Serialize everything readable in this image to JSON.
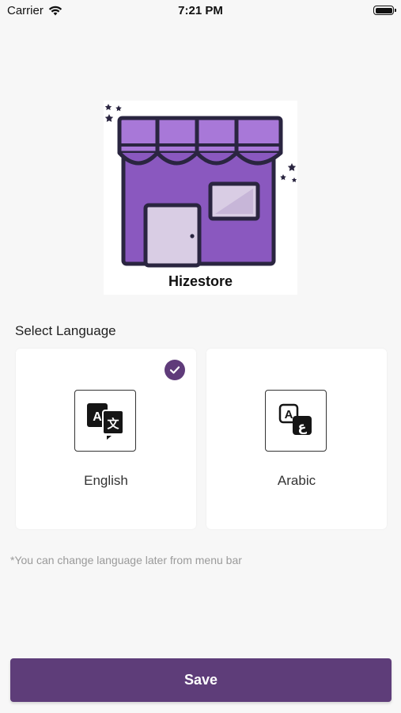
{
  "status_bar": {
    "carrier": "Carrier",
    "time": "7:21 PM"
  },
  "logo": {
    "brand_name": "Hizestore",
    "icon": "store-icon"
  },
  "language_section": {
    "title": "Select Language",
    "options": [
      {
        "label": "English",
        "icon": "translate-icon",
        "selected": true
      },
      {
        "label": "Arabic",
        "icon": "arabic-translate-icon",
        "selected": false
      }
    ],
    "hint": "*You can change language later from menu bar"
  },
  "save_button": {
    "label": "Save"
  },
  "colors": {
    "accent": "#5e3d79",
    "store_purple": "#8e5bc2",
    "background": "#f7f7f7"
  }
}
